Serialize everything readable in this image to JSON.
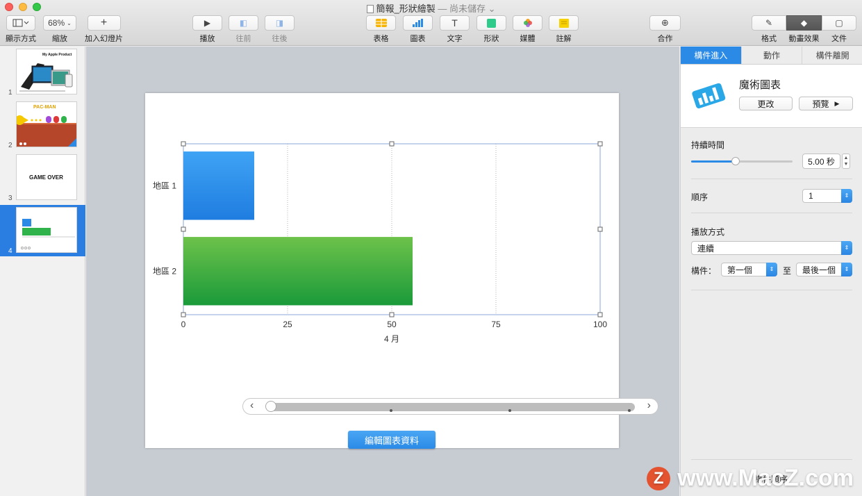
{
  "window": {
    "title": "簡報_形狀繪製",
    "status": "— 尚未儲存 ⌄"
  },
  "toolbar": {
    "view_label": "顯示方式",
    "zoom_value": "68%",
    "zoom_label": "縮放",
    "add_slide_label": "加入幻燈片",
    "play_label": "播放",
    "back_label": "往前",
    "forward_label": "往後",
    "table_label": "表格",
    "chart_label": "圖表",
    "text_label": "文字",
    "shape_label": "形狀",
    "media_label": "媒體",
    "comment_label": "註解",
    "collaborate_label": "合作",
    "format_label": "格式",
    "animate_label": "動畫效果",
    "document_label": "文件"
  },
  "navigator": {
    "slides": [
      {
        "number": "1",
        "caption": "My Apple Product"
      },
      {
        "number": "2",
        "caption": "PAC-MAN"
      },
      {
        "number": "3",
        "caption": "GAME OVER"
      },
      {
        "number": "4",
        "caption": ""
      }
    ]
  },
  "chart_data": {
    "type": "bar",
    "orientation": "horizontal",
    "categories": [
      "地區 1",
      "地區 2"
    ],
    "series": [
      {
        "values": [
          17,
          55
        ],
        "colors": [
          "#1f7de0",
          "#1a9a3a"
        ]
      }
    ],
    "xlabel": "4 月",
    "xlim": [
      0,
      100
    ],
    "xticks": [
      "0",
      "25",
      "50",
      "75",
      "100"
    ],
    "grid": true
  },
  "canvas": {
    "edit_data_label": "編輯圖表資料"
  },
  "inspector": {
    "tabs": [
      "構件進入",
      "動作",
      "構件離開"
    ],
    "effect_title": "魔術圖表",
    "change_label": "更改",
    "preview_label": "預覽",
    "duration_label": "持續時間",
    "duration_value": "5.00 秒",
    "duration_level": 0.44,
    "order_label": "順序",
    "order_value": "1",
    "delivery_label": "播放方式",
    "delivery_value": "連續",
    "build_label": "構件：",
    "build_from": "第一個",
    "build_to_label": "至",
    "build_to": "最後一個",
    "build_order_label": "構件順序"
  },
  "watermark": {
    "badge": "Z",
    "text": "www.MacZ.com"
  },
  "colors": {
    "accent": "#2a8ae6",
    "bar1": "#1f7de0",
    "bar2": "#1a9a3a",
    "canvas_bg": "#c7ccd3"
  }
}
